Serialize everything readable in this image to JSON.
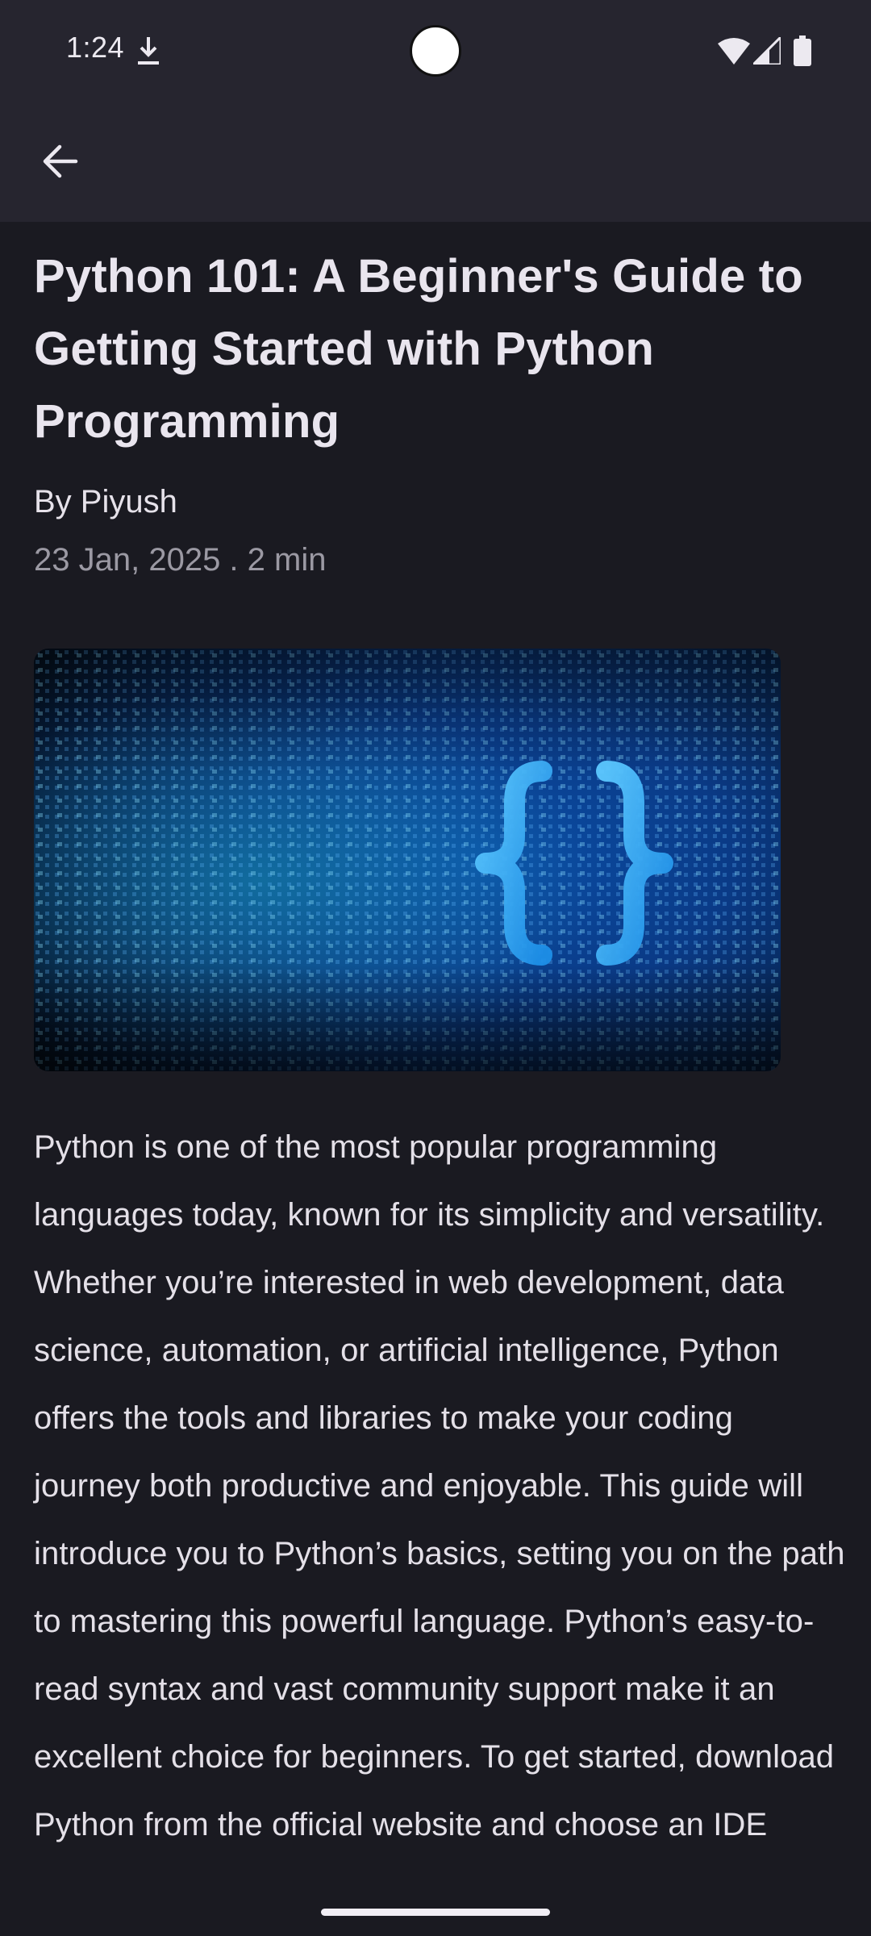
{
  "status_bar": {
    "time": "1:24",
    "icons": [
      "download-icon",
      "wifi-icon",
      "cell-signal-icon",
      "battery-icon"
    ]
  },
  "app_bar": {
    "back_icon": "arrow-left-icon"
  },
  "article": {
    "title": "Python 101: A Beginner's Guide to Getting Started with Python Programming",
    "author": "By Piyush",
    "meta": "23 Jan, 2025 . 2 min",
    "hero_image": "code-braces-illustration",
    "body": "Python is one of the most popular programming languages today, known for its simplicity and versatility. Whether you’re interested in web development, data science, automation, or artificial intelligence, Python offers the tools and libraries to make your coding journey both productive and enjoyable. This guide will introduce you to Python’s basics, setting you on the path to mastering this powerful language. Python’s easy-to-read syntax and vast community support make it an excellent choice for beginners. To get started, download Python from the official website and choose an IDE"
  },
  "colors": {
    "background": "#1a1a21",
    "app_bar": "#26252f",
    "text_primary": "#e9e5ee",
    "text_secondary": "#9b99a3"
  }
}
